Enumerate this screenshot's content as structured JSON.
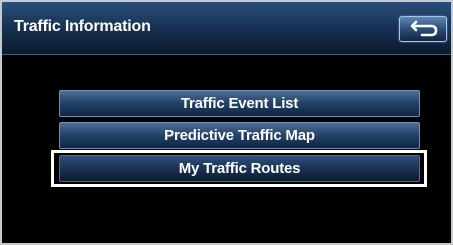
{
  "header": {
    "title": "Traffic Information",
    "back_icon": "back-arrow-icon"
  },
  "menu": {
    "items": [
      {
        "label": "Traffic Event List"
      },
      {
        "label": "Predictive Traffic Map"
      },
      {
        "label": "My Traffic Routes",
        "selected": true
      }
    ]
  },
  "colors": {
    "header_blue": "#183457",
    "button_blue": "#26456b",
    "highlight": "#ffffff",
    "background": "#000000"
  }
}
